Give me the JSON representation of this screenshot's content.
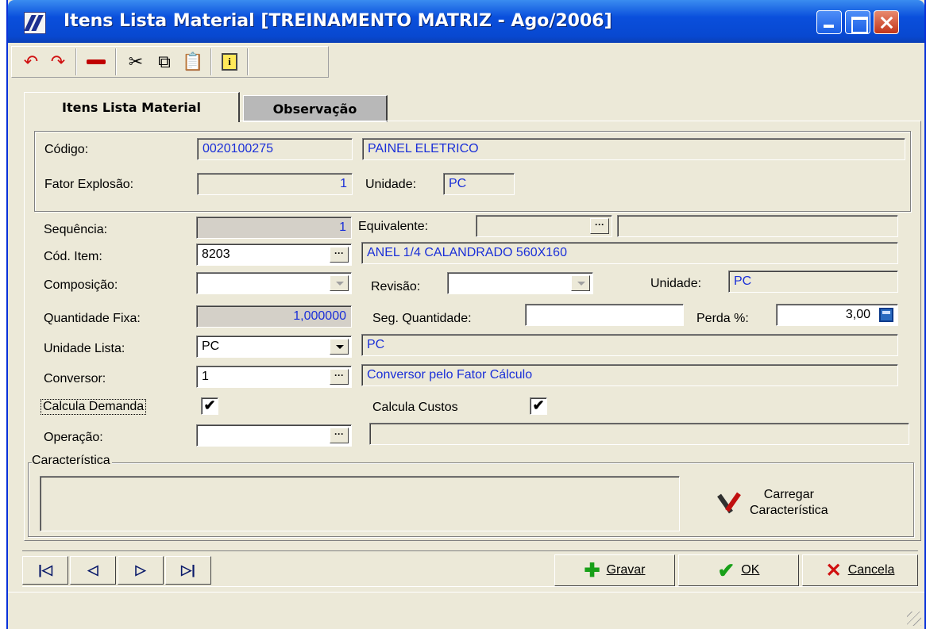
{
  "window": {
    "title": "Itens Lista Material [TREINAMENTO MATRIZ - Ago/2006]"
  },
  "toolbar": {
    "buttons": [
      "undo-icon",
      "redo-icon",
      "delete-icon",
      "cut-icon",
      "copy-icon",
      "paste-icon",
      "info-icon"
    ]
  },
  "tabs": {
    "items": [
      {
        "label": "Itens Lista Material",
        "active": true
      },
      {
        "label": "Observação",
        "active": false
      }
    ]
  },
  "header": {
    "codigo_label": "Código:",
    "codigo_value": "0020100275",
    "descricao_value": "PAINEL ELETRICO",
    "fator_label": "Fator Explosão:",
    "fator_value": "1",
    "unidade_label": "Unidade:",
    "unidade_value": "PC"
  },
  "form": {
    "sequencia_label": "Sequência:",
    "sequencia_value": "1",
    "equivalente_label": "Equivalente:",
    "equivalente_value": "",
    "equivalente_desc": "",
    "cod_item_label": "Cód. Item:",
    "cod_item_value": "8203",
    "cod_item_desc": "ANEL 1/4 CALANDRADO 560X160",
    "composicao_label": "Composição:",
    "composicao_value": "",
    "revisao_label": "Revisão:",
    "revisao_value": "",
    "unidade_label": "Unidade:",
    "unidade_value": "PC",
    "quantidade_fixa_label": "Quantidade Fixa:",
    "quantidade_fixa_value": "1,000000",
    "seg_quantidade_label": "Seg. Quantidade:",
    "seg_quantidade_value": "",
    "perda_label": "Perda %:",
    "perda_value": "3,00",
    "unidade_lista_label": "Unidade Lista:",
    "unidade_lista_value": "PC",
    "unidade_lista_desc": "PC",
    "conversor_label": "Conversor:",
    "conversor_value": "1",
    "conversor_desc": "Conversor pelo Fator Cálculo",
    "calcula_demanda_label": "Calcula Demanda",
    "calcula_demanda_checked": true,
    "calcula_custos_label": "Calcula Custos",
    "calcula_custos_checked": true,
    "operacao_label": "Operação:",
    "operacao_value": "",
    "operacao_desc": ""
  },
  "caracteristica": {
    "group_label": "Característica",
    "button_line1": "Carregar",
    "button_line2": "Característica"
  },
  "navigation": {
    "first": "first-record-icon",
    "prev": "prev-record-icon",
    "next": "next-record-icon",
    "last": "last-record-icon"
  },
  "actions": {
    "gravar_label": "Gravar",
    "ok_label": "OK",
    "cancela_label": "Cancela"
  },
  "colors": {
    "title_blue": "#0a4fdc",
    "value_blue": "#1a2fd8",
    "window_bg": "#ece9d8"
  }
}
